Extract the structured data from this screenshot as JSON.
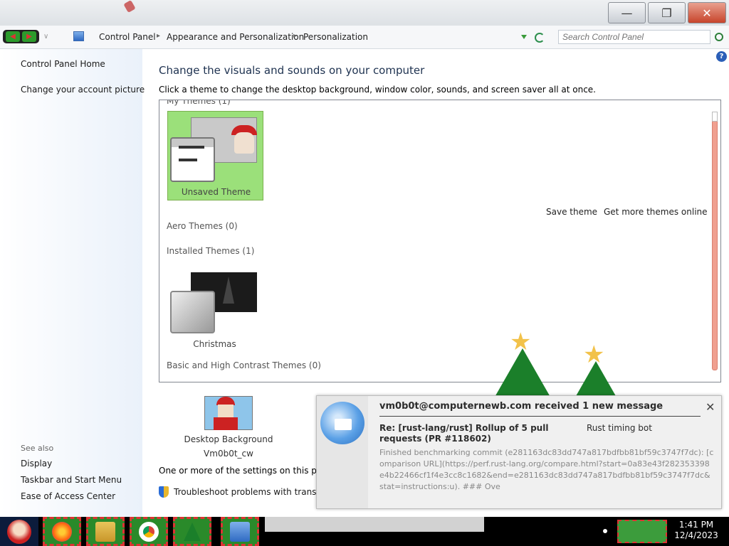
{
  "window": {
    "minimize": "—",
    "maximize": "❐",
    "close": "✕"
  },
  "address": {
    "breadcrumbs": [
      "Control Panel",
      "Appearance and Personalization",
      "Personalization"
    ],
    "search_placeholder": "Search Control Panel"
  },
  "sidebar": {
    "home": "Control Panel Home",
    "account_picture": "Change your account picture",
    "see_also": "See also",
    "links": [
      "Display",
      "Taskbar and Start Menu",
      "Ease of Access Center"
    ]
  },
  "main": {
    "title": "Change the visuals and sounds on your computer",
    "subtitle": "Click a theme to change the desktop background, window color, sounds, and screen saver all at once.",
    "my_themes_label": "My Themes (1)",
    "unsaved_theme": "Unsaved Theme",
    "save_theme": "Save theme",
    "more_themes": "Get more themes online",
    "aero_themes": "Aero Themes (0)",
    "installed_themes": "Installed Themes (1)",
    "christmas": "Christmas",
    "basic_themes": "Basic and High Contrast Themes (0)",
    "desktop_background": "Desktop Background",
    "background_name": "Vm0b0t_cw",
    "note": "One or more of the settings on this page h",
    "troubleshoot": "Troubleshoot problems with transpare"
  },
  "notification": {
    "title": "vm0b0t@computernewb.com received 1 new message",
    "subject": "Re: [rust-lang/rust] Rollup of 5 pull requests (PR #118602)",
    "from": "Rust timing bot",
    "body": "Finished benchmarking commit (e281163dc83dd747a817bdfbb81bf59c3747f7dc): [comparison URL](https://perf.rust-lang.org/compare.html?start=0a83e43f282353398e4b22466cf1f4e3cc8c1682&end=e281163dc83dd747a817bdfbb81bf59c3747f7dc&stat=instructions:u). ### Ove"
  },
  "taskbar": {
    "time": "1:41 PM",
    "date": "12/4/2023",
    "apps": [
      "firefox-icon",
      "file-explorer-icon",
      "chrome-icon",
      "christmas-tree-icon",
      "control-panel-icon"
    ]
  },
  "colors": {
    "theme_tile": "#9be07a",
    "scroll_accent": "#f0a090",
    "taskbar_item": "#2a8a2a"
  }
}
